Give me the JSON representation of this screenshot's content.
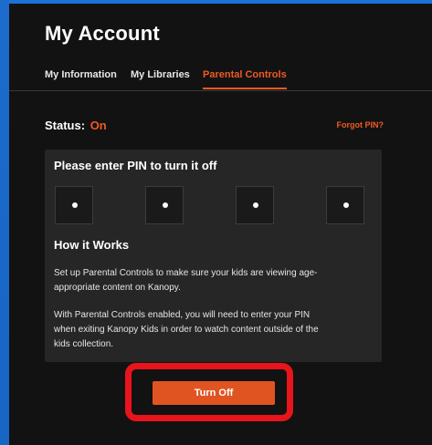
{
  "colors": {
    "accent": "#f05a22",
    "background": "#121212",
    "card": "#262626",
    "highlight": "#e8141b"
  },
  "page_title": "My Account",
  "tabs": [
    {
      "label": "My Information",
      "active": false
    },
    {
      "label": "My Libraries",
      "active": false
    },
    {
      "label": "Parental Controls",
      "active": true
    }
  ],
  "status": {
    "label": "Status:",
    "value": "On"
  },
  "forgot_pin": "Forgot PIN?",
  "pin_card": {
    "heading": "Please enter PIN to turn it off",
    "digits": [
      "•",
      "•",
      "•",
      "•"
    ]
  },
  "how_it_works": {
    "heading": "How it Works",
    "paragraph1_line1": "Set up Parental Controls to make sure your kids are viewing age-",
    "paragraph1_line2": "appropriate content on Kanopy.",
    "paragraph2_line1": "With Parental Controls enabled, you will need to enter your PIN",
    "paragraph2_line2": "when exiting Kanopy Kids in order to watch content outside of the",
    "paragraph2_line3": "kids collection."
  },
  "turn_off_button": "Turn Off"
}
